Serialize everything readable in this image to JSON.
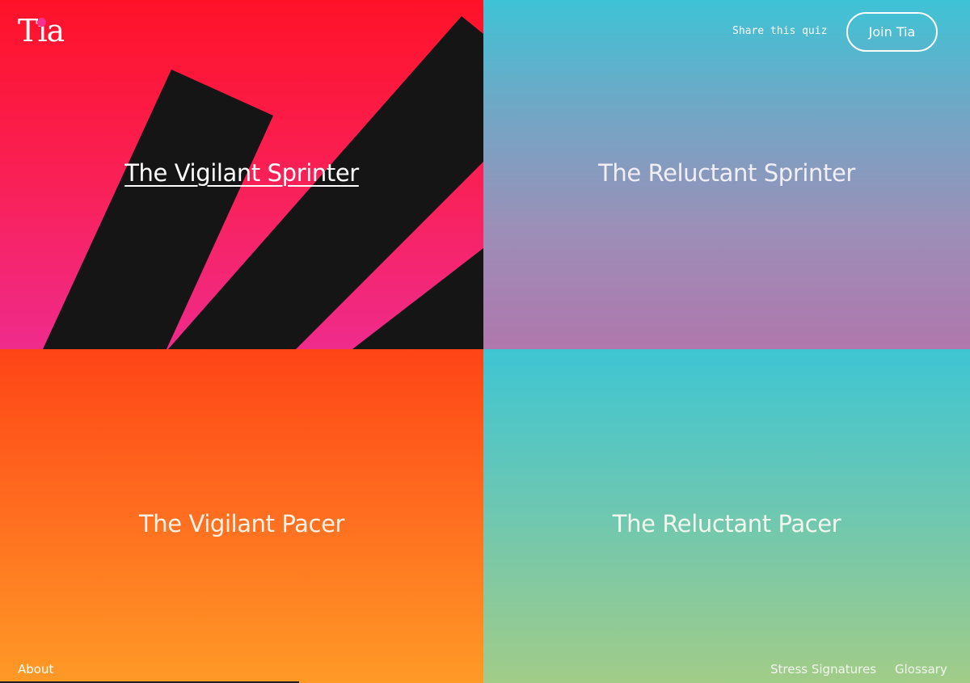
{
  "header": {
    "logo_text": "Tia",
    "logo_dot_color": "#ff2f8e",
    "share_label": "Share this quiz",
    "join_label": "Join Tia"
  },
  "tiles": [
    {
      "title": "The Vigilant Sprinter",
      "active": true,
      "gradient": [
        "#ff1228",
        "#ef2b8c"
      ],
      "decoration": "black diagonal stripes"
    },
    {
      "title": "The Reluctant Sprinter",
      "gradient": [
        "#3ec3d6",
        "#b077ac"
      ]
    },
    {
      "title": "The Vigilant Pacer",
      "gradient": [
        "#ff4416",
        "#ff9a26"
      ]
    },
    {
      "title": "The Reluctant Pacer",
      "gradient": [
        "#3ec5d3",
        "#a2cc88"
      ]
    }
  ],
  "footer": {
    "about_label": "About",
    "stress_label": "Stress Signatures",
    "glossary_label": "Glossary"
  },
  "colors": {
    "stripe": "#151515",
    "text": "#ffffff"
  }
}
